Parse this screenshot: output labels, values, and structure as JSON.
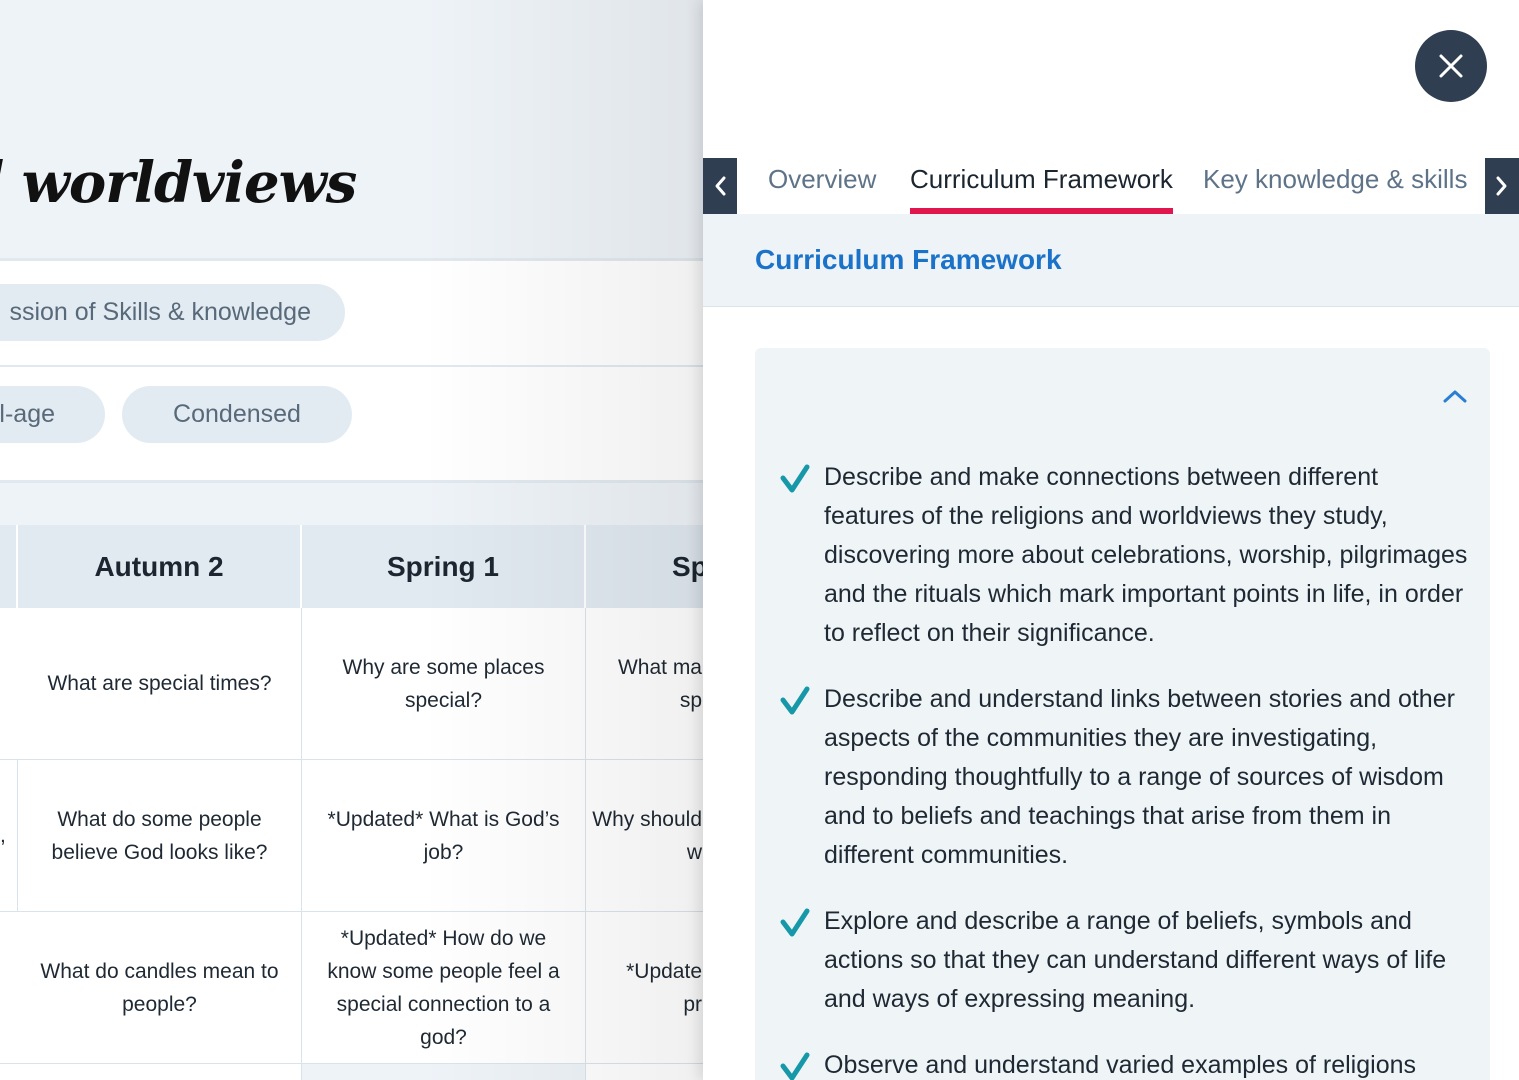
{
  "background": {
    "title": "and worldviews",
    "pills": {
      "progression": "ssion of Skills & knowledge",
      "mixed_age": "l-age",
      "condensed": "Condensed"
    },
    "table": {
      "headers": [
        "Autumn 2",
        "Spring 1",
        "Sp"
      ],
      "rows": [
        [
          "What are special times?",
          "Why are some places special?",
          "What ma\nsp"
        ],
        [
          "What do some people believe God looks like?",
          "*Updated* What is God’s job?",
          "Why should\nw"
        ],
        [
          "What do candles mean to people?",
          "*Updated* How do we know some people feel a special connection to a god?",
          "*Update\npr"
        ]
      ],
      "edge_marks": [
        "",
        ",",
        ""
      ]
    }
  },
  "panel": {
    "close_icon": "close-icon",
    "tabs": [
      {
        "label": "Overview",
        "active": false
      },
      {
        "label": "Curriculum Framework",
        "active": true
      },
      {
        "label": "Key knowledge & skills",
        "active": false
      }
    ],
    "section_title": "Curriculum Framework",
    "items": [
      "Describe and make connections between different features of the religions and worldviews they study, discovering more about celebrations, worship, pilgrimages and the rituals which mark important points in life, in order to reflect on their significance.",
      "Describe and understand links between stories and other aspects of the communities they are investigating, responding thoughtfully to a range of sources of wisdom and to beliefs and teachings that arise from them in different communities.",
      "Explore and describe a range of beliefs, symbols and actions so that they can understand different ways of life and ways of expressing meaning.",
      "Observe and understand varied examples of religions"
    ]
  },
  "colors": {
    "accent": "#e0164f",
    "link": "#1a73c9",
    "dark": "#2f3e50",
    "check": "#1798a8"
  }
}
